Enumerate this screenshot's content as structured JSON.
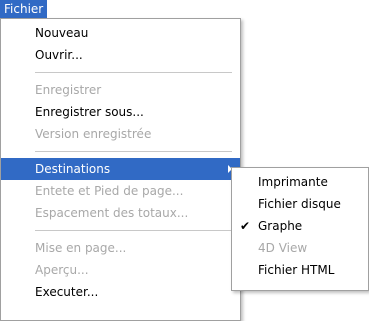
{
  "menubar": {
    "file_label": "Fichier"
  },
  "menu": {
    "items": [
      {
        "label": "Nouveau",
        "disabled": false
      },
      {
        "label": "Ouvrir...",
        "disabled": false
      },
      {
        "label": "Enregistrer",
        "disabled": true
      },
      {
        "label": "Enregistrer sous...",
        "disabled": false
      },
      {
        "label": "Version enregistrée",
        "disabled": true
      },
      {
        "label": "Destinations",
        "disabled": false,
        "highlighted": true,
        "has_submenu": true
      },
      {
        "label": "Entete et Pied de page...",
        "disabled": true
      },
      {
        "label": "Espacement des totaux...",
        "disabled": true
      },
      {
        "label": "Mise en page...",
        "disabled": true
      },
      {
        "label": "Aperçu...",
        "disabled": true
      },
      {
        "label": "Executer...",
        "disabled": false
      }
    ]
  },
  "submenu": {
    "items": [
      {
        "label": "Imprimante",
        "disabled": false,
        "checked": false
      },
      {
        "label": "Fichier disque",
        "disabled": false,
        "checked": false
      },
      {
        "label": "Graphe",
        "disabled": false,
        "checked": true
      },
      {
        "label": "4D View",
        "disabled": true,
        "checked": false
      },
      {
        "label": "Fichier HTML",
        "disabled": false,
        "checked": false
      }
    ],
    "check_glyph": "✔"
  },
  "colors": {
    "highlight": "#316ac5",
    "disabled_text": "#a8a8a8"
  }
}
